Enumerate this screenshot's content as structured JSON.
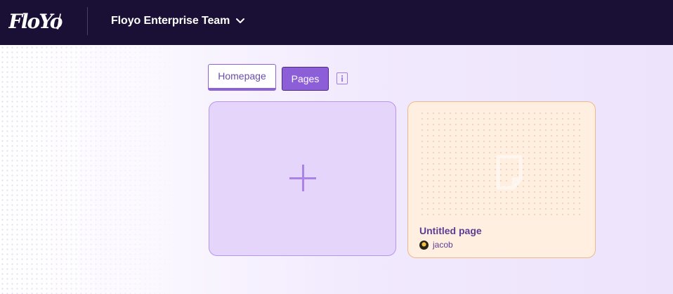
{
  "app": {
    "logo_text": "FloYo!",
    "team_name": "Floyo Enterprise Team",
    "team_menu_icon": "chevron-down-icon"
  },
  "tabs": [
    {
      "label": "Homepage",
      "active": false
    },
    {
      "label": "Pages",
      "active": true
    }
  ],
  "info_icon": "info-icon",
  "new_page_card": {
    "icon": "plus-icon"
  },
  "pages": [
    {
      "title": "Untitled page",
      "owner": "jacob",
      "thumbnail_icon": "page-icon"
    }
  ],
  "colors": {
    "nav_bg": "#1a0f35",
    "accent": "#8c5fd9",
    "new_card_bg": "#e5d5fb",
    "page_card_bg": "#ffefe1",
    "page_card_border": "#f0b886"
  }
}
